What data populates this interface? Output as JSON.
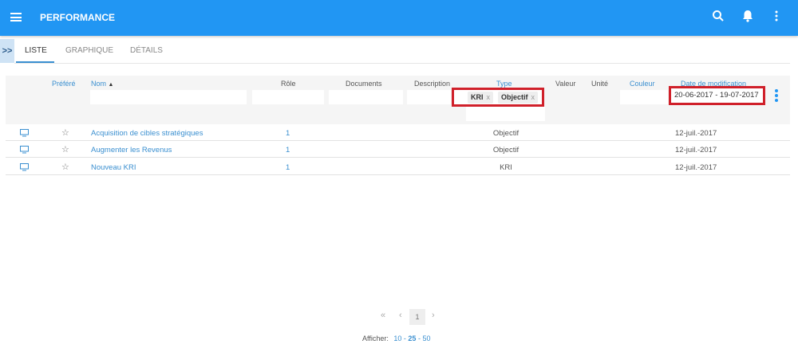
{
  "header": {
    "title": "PERFORMANCE",
    "icons": [
      "menu-icon",
      "search-icon",
      "bell-icon",
      "more-vertical-icon"
    ]
  },
  "tabs": [
    {
      "label": "LISTE"
    },
    {
      "label": "GRAPHIQUE"
    },
    {
      "label": "DÉTAILS"
    }
  ],
  "table": {
    "columns": {
      "prefere": "Préféré",
      "nom": "Nom",
      "role": "Rôle",
      "documents": "Documents",
      "description": "Description",
      "type": "Type",
      "valeur": "Valeur",
      "unite": "Unité",
      "couleur": "Couleur",
      "date": "Date de modification"
    },
    "filters": {
      "type_chips": [
        "KRI",
        "Objectif"
      ],
      "chip_remove": "x",
      "date_range": "20-06-2017 - 19-07-2017"
    },
    "rows": [
      {
        "nom": "Acquisition de cibles stratégiques",
        "role": "1",
        "type": "Objectif",
        "date": "12-juil.-2017"
      },
      {
        "nom": "Augmenter les Revenus",
        "role": "1",
        "type": "Objectif",
        "date": "12-juil.-2017"
      },
      {
        "nom": "Nouveau KRI",
        "role": "1",
        "type": "KRI",
        "date": "12-juil.-2017"
      }
    ]
  },
  "pagination": {
    "first": "«",
    "prev": "‹",
    "current": "1",
    "next": "›",
    "show_label": "Afficher:",
    "sizes": [
      "10",
      "25",
      "50"
    ],
    "sep": "-"
  },
  "colors": {
    "primary": "#2196f3",
    "link": "#3a8fd0",
    "highlight": "#d0202a"
  }
}
